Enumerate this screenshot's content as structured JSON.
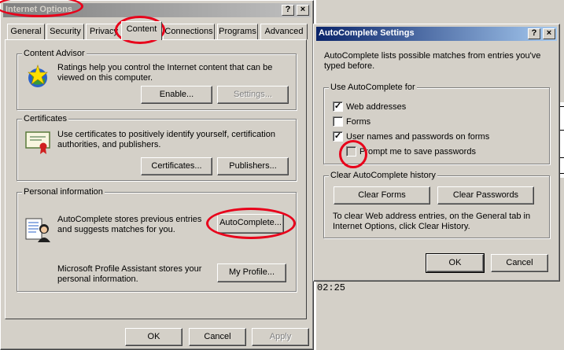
{
  "internet_options": {
    "title": "Internet Options",
    "tabs": [
      "General",
      "Security",
      "Privacy",
      "Content",
      "Connections",
      "Programs",
      "Advanced"
    ],
    "content_advisor": {
      "group_label": "Content Advisor",
      "description": "Ratings help you control the Internet content that can be viewed on this computer.",
      "enable_label": "Enable...",
      "settings_label": "Settings..."
    },
    "certificates": {
      "group_label": "Certificates",
      "description": "Use certificates to positively identify yourself, certification authorities, and publishers.",
      "certificates_label": "Certificates...",
      "publishers_label": "Publishers..."
    },
    "personal_information": {
      "group_label": "Personal information",
      "autocomplete_text": "AutoComplete stores previous entries and suggests matches for you.",
      "autocomplete_label": "AutoComplete...",
      "profile_text": "Microsoft Profile Assistant stores your personal information.",
      "profile_label": "My Profile..."
    },
    "ok_label": "OK",
    "cancel_label": "Cancel",
    "apply_label": "Apply"
  },
  "autocomplete_settings": {
    "title": "AutoComplete Settings",
    "intro": "AutoComplete lists possible matches from entries you've typed before.",
    "use_group_label": "Use AutoComplete for",
    "options": [
      {
        "label": "Web addresses",
        "checked": true,
        "enabled": true
      },
      {
        "label": "Forms",
        "checked": false,
        "enabled": true
      },
      {
        "label": "User names and passwords on forms",
        "checked": true,
        "enabled": true
      },
      {
        "label": "Prompt me to save passwords",
        "checked": false,
        "enabled": false
      }
    ],
    "clear_group_label": "Clear AutoComplete history",
    "clear_forms_label": "Clear Forms",
    "clear_passwords_label": "Clear Passwords",
    "clear_note": "To clear Web address entries, on the General tab in Internet Options, click Clear History.",
    "ok_label": "OK",
    "cancel_label": "Cancel"
  },
  "background": {
    "time": "02:25"
  },
  "window_buttons": {
    "help": "?",
    "close": "×"
  }
}
